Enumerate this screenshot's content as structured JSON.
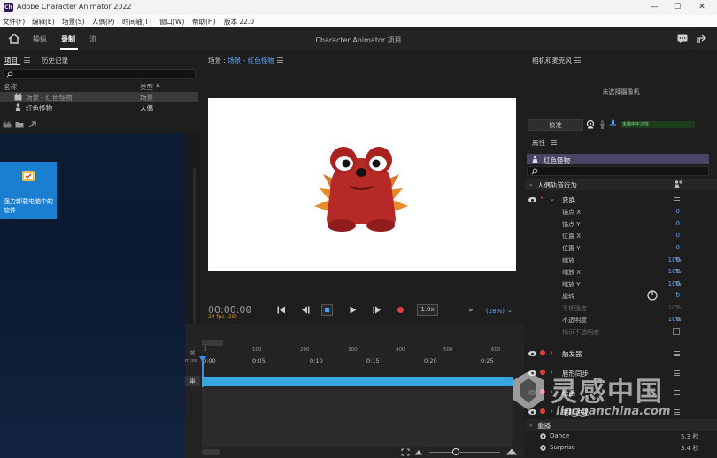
{
  "titlebar": {
    "app_icon": "Ch",
    "title": "Adobe Character Animator 2022",
    "minimize": "—",
    "maximize": "☐",
    "close": "✕"
  },
  "menu": [
    "文件(F)",
    "编辑(E)",
    "场景(S)",
    "人偶(P)",
    "时间轴(T)",
    "窗口(W)",
    "帮助(H)",
    "版本 22.0"
  ],
  "workspace": {
    "tabs": [
      "操纵",
      "录制",
      "流"
    ],
    "active": "录制",
    "project_title": "Character Animator 项目"
  },
  "project": {
    "tabs": [
      "项目",
      "历史记录"
    ],
    "columns": [
      "名称",
      "类型"
    ],
    "items": [
      {
        "name": "场景 - 红色怪物",
        "type": "场景"
      },
      {
        "name": "红色怪物",
        "type": "人偶"
      }
    ]
  },
  "desktop": {
    "tile_label": "强力卸载电脑中的软件"
  },
  "scene": {
    "title_prefix": "场景 : ",
    "title_link": "场景 - 红色怪物",
    "timecode": "00:00:00",
    "timecode_frame": "0",
    "fps": "24 fps (25)",
    "speed": "1.0x",
    "zoom": "(28%)",
    "more": "»"
  },
  "timeline": {
    "frame_label": "帧",
    "ms_label": "m:ss",
    "ticks": [
      "0",
      "100",
      "200",
      "300",
      "400",
      "500",
      "600"
    ],
    "times": [
      "0:00",
      "0:05",
      "0:10",
      "0:15",
      "0:20",
      "0:25"
    ],
    "track_label": "串"
  },
  "camera": {
    "title": "相机和麦克风",
    "no_camera": "未选择摄像机",
    "calibrate": "校准",
    "mic_status": "未确电平过低"
  },
  "properties": {
    "title": "属性",
    "puppet": "红色怪物",
    "track_behavior": "人偶轨道行为",
    "transform": "变换",
    "rows": [
      {
        "label": "锚点 X",
        "value": "0",
        "unit": ""
      },
      {
        "label": "锚点 Y",
        "value": "0",
        "unit": ""
      },
      {
        "label": "位置 X",
        "value": "0",
        "unit": ""
      },
      {
        "label": "位置 Y",
        "value": "0",
        "unit": ""
      },
      {
        "label": "缩放",
        "value": "100",
        "unit": "%"
      },
      {
        "label": "缩放 X",
        "value": "100",
        "unit": "%"
      },
      {
        "label": "缩放 Y",
        "value": "100",
        "unit": "%"
      },
      {
        "label": "旋转",
        "value": "0",
        "unit": "°"
      },
      {
        "label": "手柄强度",
        "value": "100",
        "unit": "%"
      },
      {
        "label": "不透明度",
        "value": "100",
        "unit": "%"
      },
      {
        "label": "揭示不透明度",
        "value": "",
        "unit": ""
      }
    ],
    "behaviors": [
      "触发器",
      "唇形同步",
      "绘画",
      "眼睛注视"
    ],
    "replay": "重播",
    "replays": [
      {
        "name": "Dance",
        "duration": "5.3 秒"
      },
      {
        "name": "Surprise",
        "duration": "3.4 秒"
      }
    ]
  },
  "watermark": {
    "title": "灵感中国",
    "url": "lingganchina.com"
  },
  "colors": {
    "accent": "#5fa8ff",
    "timeline_bar": "#3aa6e0",
    "record": "#e23b3b",
    "puppet_row": "#4a4466"
  }
}
